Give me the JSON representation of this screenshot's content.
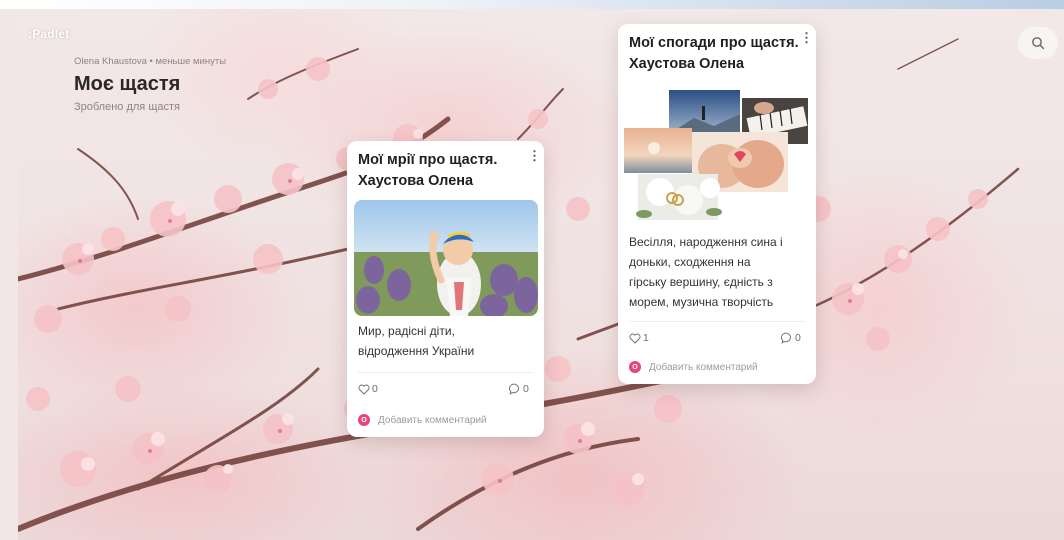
{
  "app": {
    "logo": ":Padlet"
  },
  "board": {
    "meta": "Olena Khaustova • меньше минуты",
    "title": "Моє щастя",
    "subtitle": "Зроблено для щастя"
  },
  "icons": {
    "search": "search-icon",
    "kebab": "more-vertical-icon",
    "heart": "heart-icon",
    "comment": "comment-icon"
  },
  "colors": {
    "accent": "#e8457d",
    "background": "#f2e3e3",
    "card": "#ffffff"
  },
  "cards": [
    {
      "title": "Мої мрії про щастя. Хаустова Олена",
      "text_lines": [
        "Мир, радісні діти,",
        "відродження України"
      ],
      "likes": "0",
      "comments": "0",
      "add_comment": "Добавить комментарий",
      "avatar_letter": "O"
    },
    {
      "title": "Мої спогади про щастя. Хаустова Олена",
      "text_lines": [
        "Весілля, народження сина і",
        "доньки, сходження на",
        "гірську вершину, єдність з",
        "морем, музична творчість"
      ],
      "likes": "1",
      "comments": "0",
      "add_comment": "Добавить комментарий",
      "avatar_letter": "O"
    }
  ]
}
